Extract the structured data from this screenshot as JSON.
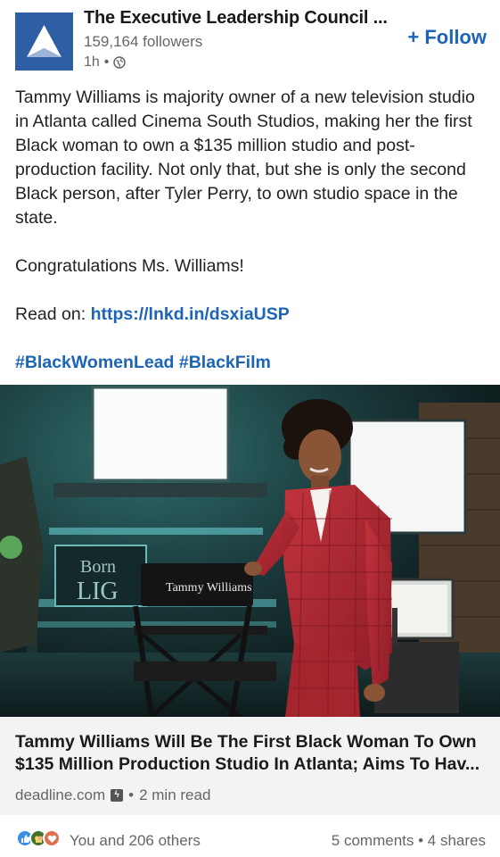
{
  "header": {
    "company_name": "The Executive Leadership Council ...",
    "followers": "159,164 followers",
    "time_ago": "1h",
    "separator": "•",
    "follow_label": "+ Follow",
    "logo_color": "#2e5ea4"
  },
  "post": {
    "paragraph_1": "Tammy Williams is majority owner of a new television studio in Atlanta called Cinema South Studios, making her the first Black woman to own a $135 million studio and post-production facility. Not only that, but she is only the second Black person, after Tyler Perry, to own studio space in the state.",
    "paragraph_2": "Congratulations Ms. Williams!",
    "read_on_prefix": "Read on: ",
    "read_on_link": "https://lnkd.in/dsxiaUSP",
    "hashtag_1": "#BlackWomenLead",
    "hashtag_2": "#BlackFilm",
    "link_color": "#1c64b8"
  },
  "photo": {
    "chair_label": "Tammy Williams",
    "sign_text_1": "Born",
    "sign_text_2": "LIG"
  },
  "article": {
    "title": "Tammy Williams Will Be The First Black Woman To Own $135 Million Production Studio In Atlanta; Aims To Hav...",
    "source": "deadline.com",
    "amp_glyph": "ϟ",
    "read_time": "2 min read",
    "separator": "•"
  },
  "footer": {
    "reaction_icons": [
      "like-icon",
      "celebrate-icon",
      "love-icon"
    ],
    "reactions_text": "You and 206 others",
    "comments": "5 comments",
    "separator": "•",
    "shares": "4 shares"
  }
}
